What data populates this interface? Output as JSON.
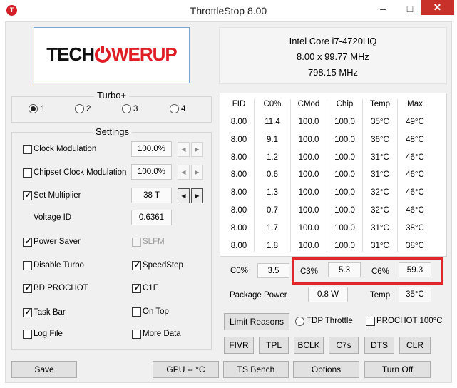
{
  "window": {
    "title": "ThrottleStop 8.00",
    "app_icon": "T",
    "min": "–",
    "max": "□",
    "close": "✕"
  },
  "logo": {
    "part1": "TECH",
    "part2": "WERUP"
  },
  "cpu": {
    "name": "Intel Core i7-4720HQ",
    "multiplier": "8.00 x 99.77 MHz",
    "speed": "798.15 MHz"
  },
  "turbo": {
    "title": "Turbo+",
    "profiles": [
      {
        "label": "1",
        "selected": true
      },
      {
        "label": "2",
        "selected": false
      },
      {
        "label": "3",
        "selected": false
      },
      {
        "label": "4",
        "selected": false
      }
    ]
  },
  "settings": {
    "title": "Settings",
    "clock_modulation": {
      "label": "Clock Modulation",
      "checked": false,
      "value": "100.0%"
    },
    "chipset_clock_modulation": {
      "label": "Chipset Clock Modulation",
      "checked": false,
      "value": "100.0%"
    },
    "set_multiplier": {
      "label": "Set Multiplier",
      "checked": true,
      "value": "38 T"
    },
    "voltage_id": {
      "label": "Voltage ID",
      "value": "0.6361"
    },
    "power_saver": {
      "label": "Power Saver",
      "checked": true
    },
    "slfm": {
      "label": "SLFM",
      "checked": false
    },
    "disable_turbo": {
      "label": "Disable Turbo",
      "checked": false
    },
    "speedstep": {
      "label": "SpeedStep",
      "checked": true
    },
    "bd_prochot": {
      "label": "BD PROCHOT",
      "checked": true
    },
    "c1e": {
      "label": "C1E",
      "checked": true
    },
    "task_bar": {
      "label": "Task Bar",
      "checked": true
    },
    "on_top": {
      "label": "On Top",
      "checked": false
    },
    "log_file": {
      "label": "Log File",
      "checked": false
    },
    "more_data": {
      "label": "More Data",
      "checked": false
    },
    "spin_left": "◀",
    "spin_right": "▶"
  },
  "table": {
    "headers": [
      "FID",
      "C0%",
      "CMod",
      "Chip",
      "Temp",
      "Max"
    ],
    "rows": [
      [
        "8.00",
        "11.4",
        "100.0",
        "100.0",
        "35°C",
        "49°C"
      ],
      [
        "8.00",
        "9.1",
        "100.0",
        "100.0",
        "36°C",
        "48°C"
      ],
      [
        "8.00",
        "1.2",
        "100.0",
        "100.0",
        "31°C",
        "46°C"
      ],
      [
        "8.00",
        "0.6",
        "100.0",
        "100.0",
        "31°C",
        "46°C"
      ],
      [
        "8.00",
        "1.3",
        "100.0",
        "100.0",
        "32°C",
        "46°C"
      ],
      [
        "8.00",
        "0.7",
        "100.0",
        "100.0",
        "32°C",
        "46°C"
      ],
      [
        "8.00",
        "1.7",
        "100.0",
        "100.0",
        "31°C",
        "38°C"
      ],
      [
        "8.00",
        "1.8",
        "100.0",
        "100.0",
        "31°C",
        "38°C"
      ]
    ]
  },
  "stats": {
    "c0_label": "C0%",
    "c0_value": "3.5",
    "c3_label": "C3%",
    "c3_value": "5.3",
    "c6_label": "C6%",
    "c6_value": "59.3",
    "pkg_power_label": "Package Power",
    "pkg_power_value": "0.8 W",
    "temp_label": "Temp",
    "temp_value": "35°C",
    "highlight_color": "#e0252d"
  },
  "limits": {
    "limit_reasons": "Limit Reasons",
    "tdp_throttle": {
      "label": "TDP Throttle",
      "selected": false
    },
    "prochot_100": {
      "label": "PROCHOT 100°C",
      "checked": false
    }
  },
  "feature_buttons": [
    "FIVR",
    "TPL",
    "BCLK",
    "C7s",
    "DTS",
    "CLR"
  ],
  "bottom_buttons": {
    "save": "Save",
    "gpu": "GPU -- °C",
    "ts_bench": "TS Bench",
    "options": "Options",
    "turn_off": "Turn Off"
  }
}
